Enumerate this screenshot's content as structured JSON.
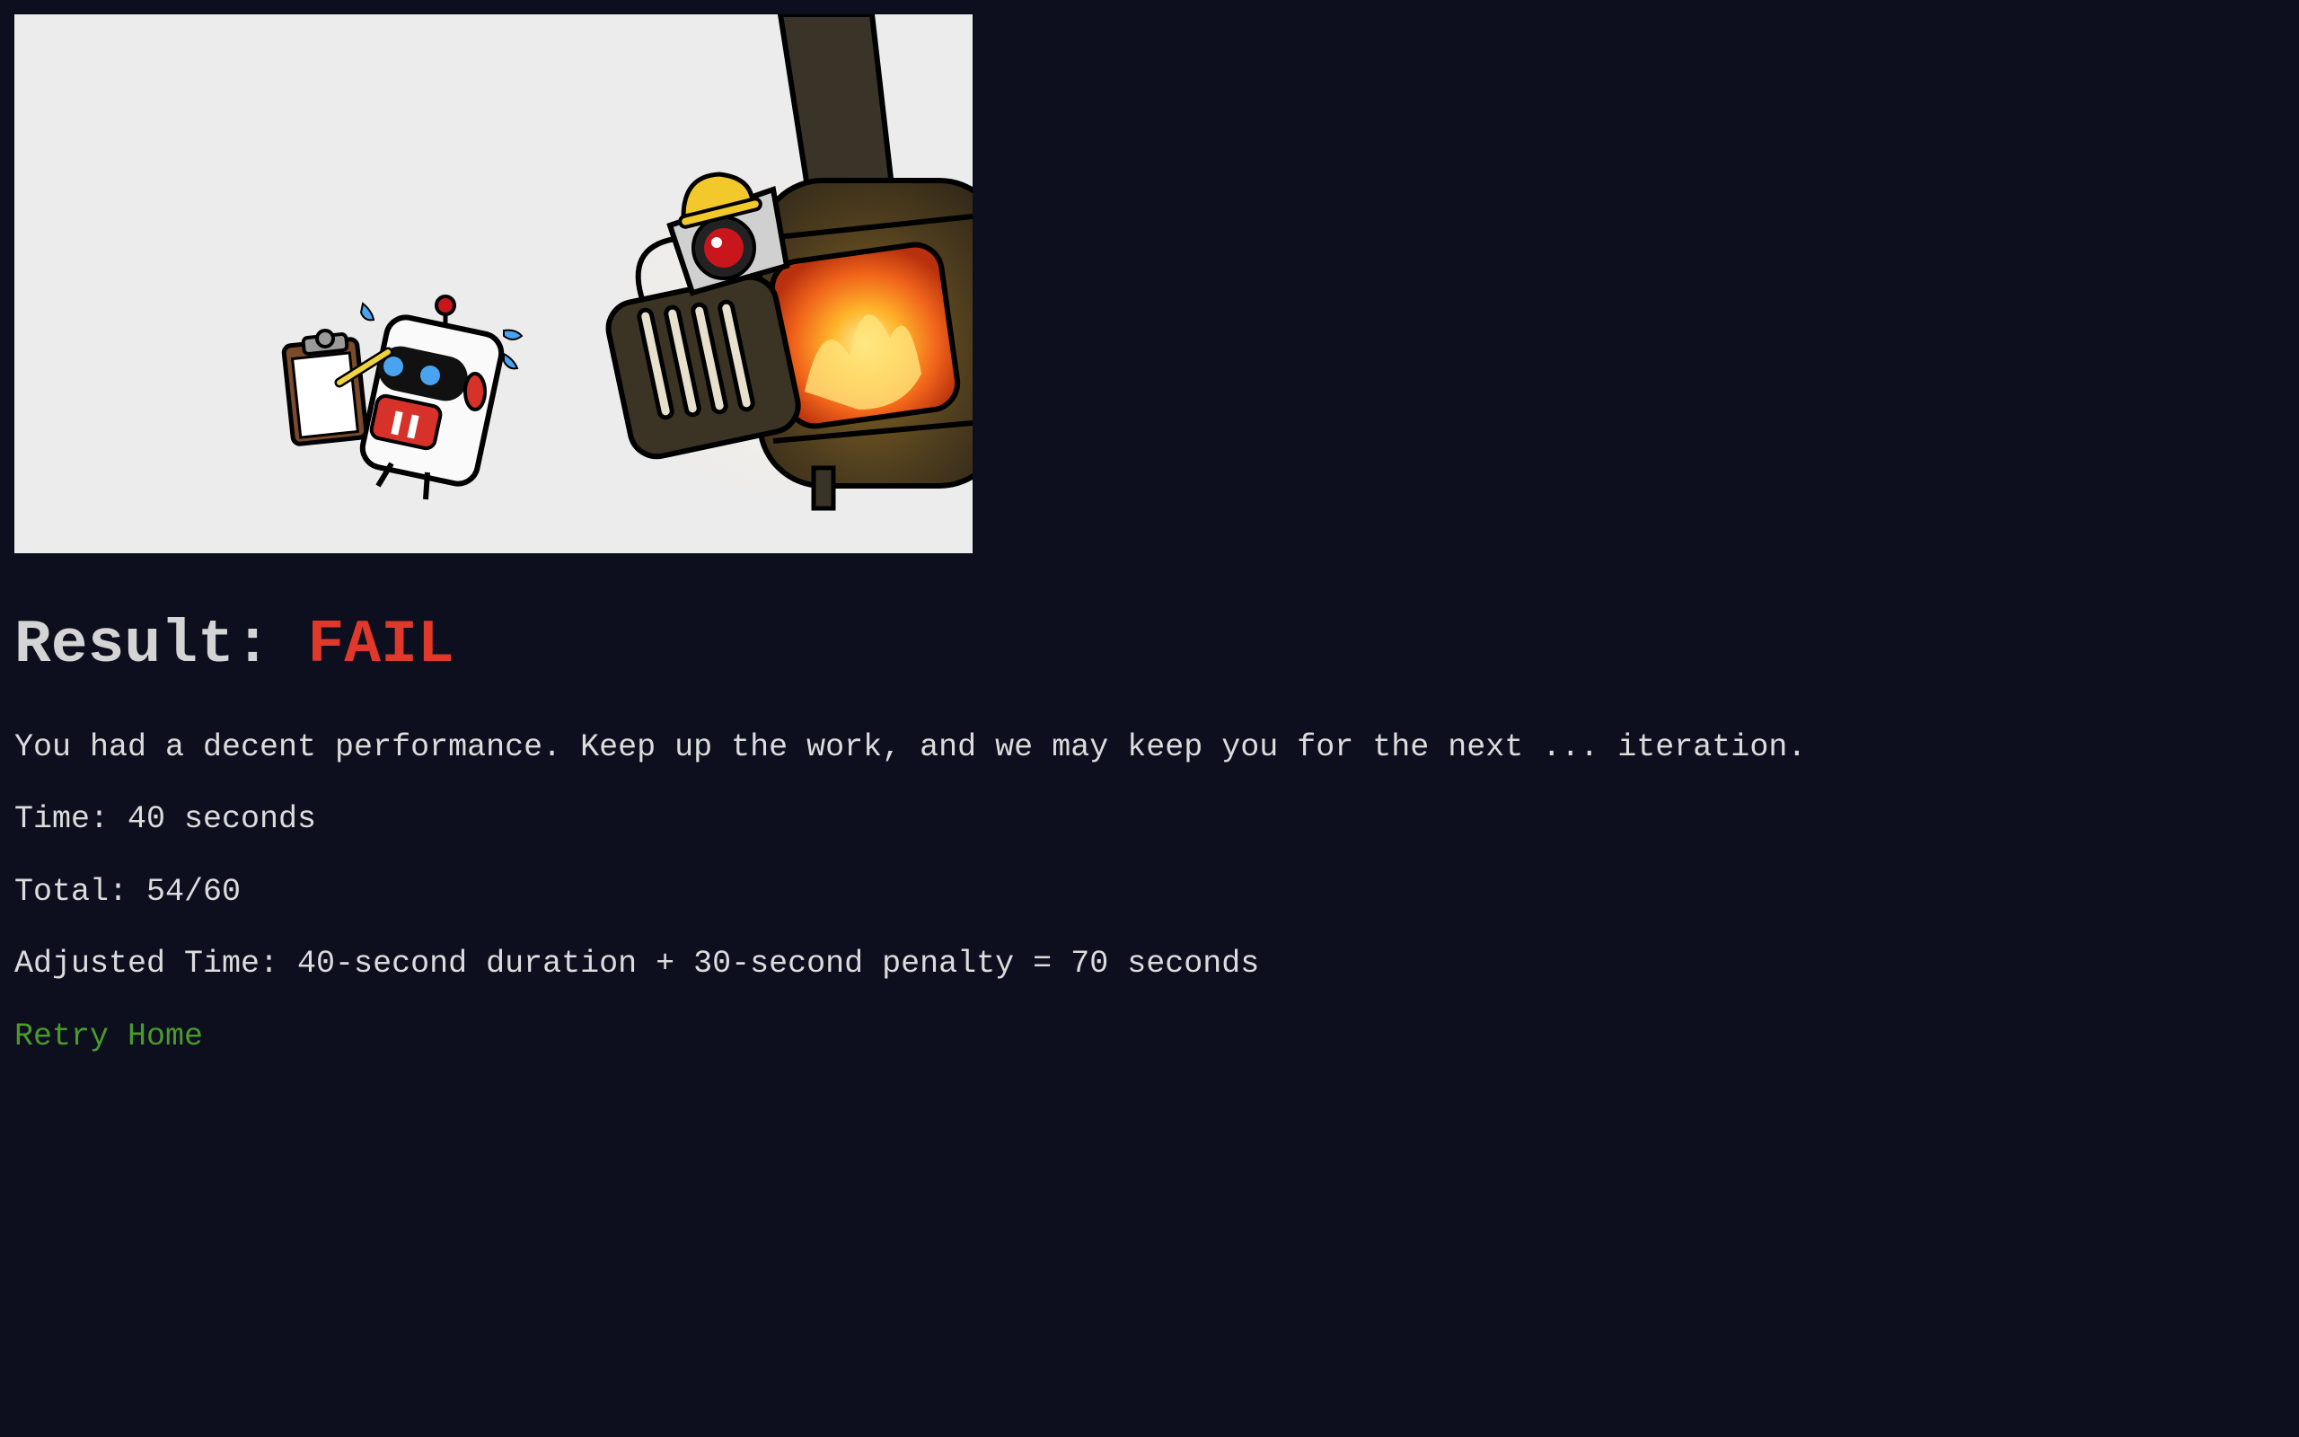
{
  "illustration": {
    "alt": "robot-with-clipboard-and-furnace-robot"
  },
  "result": {
    "label": "Result:",
    "status": "FAIL",
    "status_color": "#e0382b"
  },
  "message": "You had a decent performance. Keep up the work, and we may keep you for the next ... iteration.",
  "stats": {
    "time": "Time: 40 seconds",
    "total": "Total: 54/60",
    "adjusted": "Adjusted Time: 40-second duration + 30-second penalty = 70 seconds"
  },
  "links": {
    "retry": "Retry",
    "home": "Home"
  },
  "colors": {
    "background": "#0d0f1f",
    "text": "#dcdcdc",
    "link": "#4a9a2c"
  }
}
